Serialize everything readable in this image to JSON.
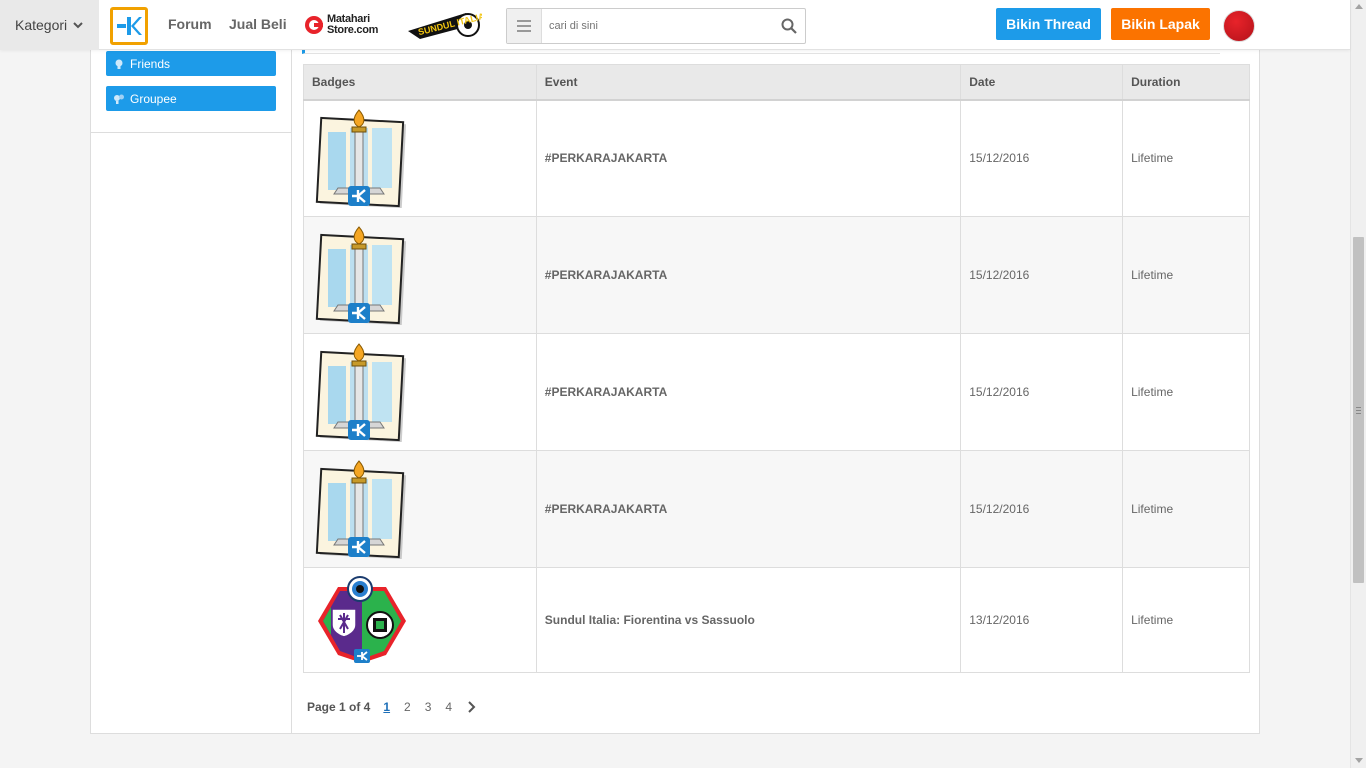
{
  "header": {
    "kategori_label": "Kategori",
    "nav": {
      "forum": "Forum",
      "jual_beli": "Jual Beli"
    },
    "matahari_text_1": "Matahari",
    "matahari_text_2": "Store.com",
    "sundul_text": "SUNDUL ITALIA",
    "search_placeholder": "cari di sini",
    "bikin_thread": "Bikin Thread",
    "bikin_lapak": "Bikin Lapak",
    "colors": {
      "blue": "#1d9be9",
      "orange": "#fb7300",
      "logo_border": "#f1a100"
    }
  },
  "sidebar": {
    "items": [
      {
        "label": "Friends",
        "icon": "bulb-icon"
      },
      {
        "label": "Groupee",
        "icon": "group-bulb-icon"
      }
    ]
  },
  "table": {
    "headers": {
      "badges": "Badges",
      "event": "Event",
      "date": "Date",
      "duration": "Duration"
    },
    "rows": [
      {
        "badge": "monas-badge-icon",
        "event": "#PERKARAJAKARTA",
        "date": "15/12/2016",
        "duration": "Lifetime"
      },
      {
        "badge": "monas-badge-icon",
        "event": "#PERKARAJAKARTA",
        "date": "15/12/2016",
        "duration": "Lifetime"
      },
      {
        "badge": "monas-badge-icon",
        "event": "#PERKARAJAKARTA",
        "date": "15/12/2016",
        "duration": "Lifetime"
      },
      {
        "badge": "monas-badge-icon",
        "event": "#PERKARAJAKARTA",
        "date": "15/12/2016",
        "duration": "Lifetime"
      },
      {
        "badge": "sundul-italia-badge-icon",
        "event": "Sundul Italia: Fiorentina vs Sassuolo",
        "date": "13/12/2016",
        "duration": "Lifetime"
      }
    ]
  },
  "pagination": {
    "info": "Page 1 of 4",
    "pages": [
      "1",
      "2",
      "3",
      "4"
    ],
    "current": "1"
  }
}
